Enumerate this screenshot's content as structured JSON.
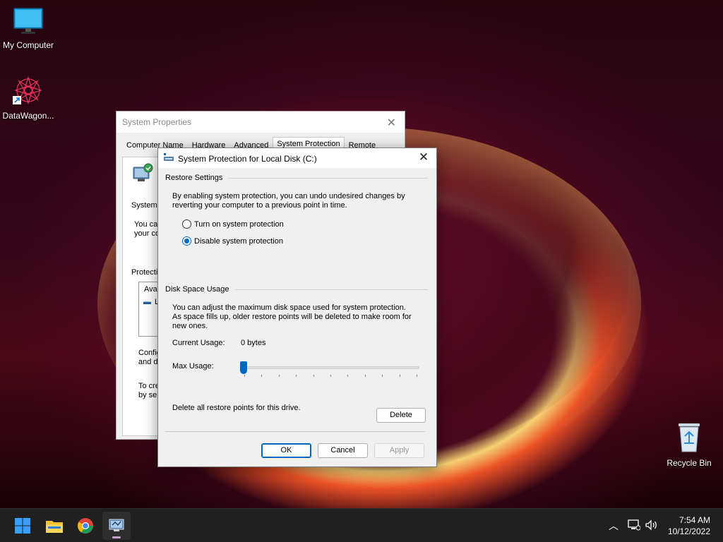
{
  "desktop": {
    "icons": [
      {
        "label": "My Computer",
        "icon": "monitor-icon"
      },
      {
        "label": "DataWagon...",
        "icon": "datawagon-app-icon"
      },
      {
        "label": "Recycle Bin",
        "icon": "recycle-bin-icon"
      }
    ]
  },
  "system_properties": {
    "title": "System Properties",
    "tabs": [
      "Computer Name",
      "Hardware",
      "Advanced",
      "System Protection",
      "Remote"
    ],
    "active_tab": "System Protection",
    "partial_texts": {
      "system": "System",
      "you_can_1": "You ca",
      "you_can_2": "your co",
      "protection": "Protecti",
      "available": "Avai",
      "drive_l": "L",
      "config_1": "Config",
      "config_2": "and de",
      "to_create_1": "To cre",
      "to_create_2": "by sel"
    }
  },
  "dialog": {
    "title": "System Protection for Local Disk (C:)",
    "restore_settings": {
      "heading": "Restore Settings",
      "description": "By enabling system protection, you can undo undesired changes by reverting your computer to a previous point in time.",
      "options": [
        {
          "label": "Turn on system protection",
          "checked": false
        },
        {
          "label": "Disable system protection",
          "checked": true
        }
      ]
    },
    "disk_space": {
      "heading": "Disk Space Usage",
      "description": "You can adjust the maximum disk space used for system protection. As space fills up, older restore points will be deleted to make room for new ones.",
      "current_usage_label": "Current Usage:",
      "current_usage_value": "0 bytes",
      "max_usage_label": "Max Usage:",
      "max_usage_fraction": 0.0,
      "delete_text": "Delete all restore points for this drive.",
      "delete_button": "Delete"
    },
    "buttons": {
      "ok": "OK",
      "cancel": "Cancel",
      "apply": "Apply"
    }
  },
  "taskbar": {
    "items": [
      "windows-start-icon",
      "file-explorer-icon",
      "chrome-icon",
      "system-properties-icon"
    ],
    "time": "7:54 AM",
    "date": "10/12/2022"
  },
  "colors": {
    "accent": "#0067c0",
    "taskbar": "#202020"
  }
}
